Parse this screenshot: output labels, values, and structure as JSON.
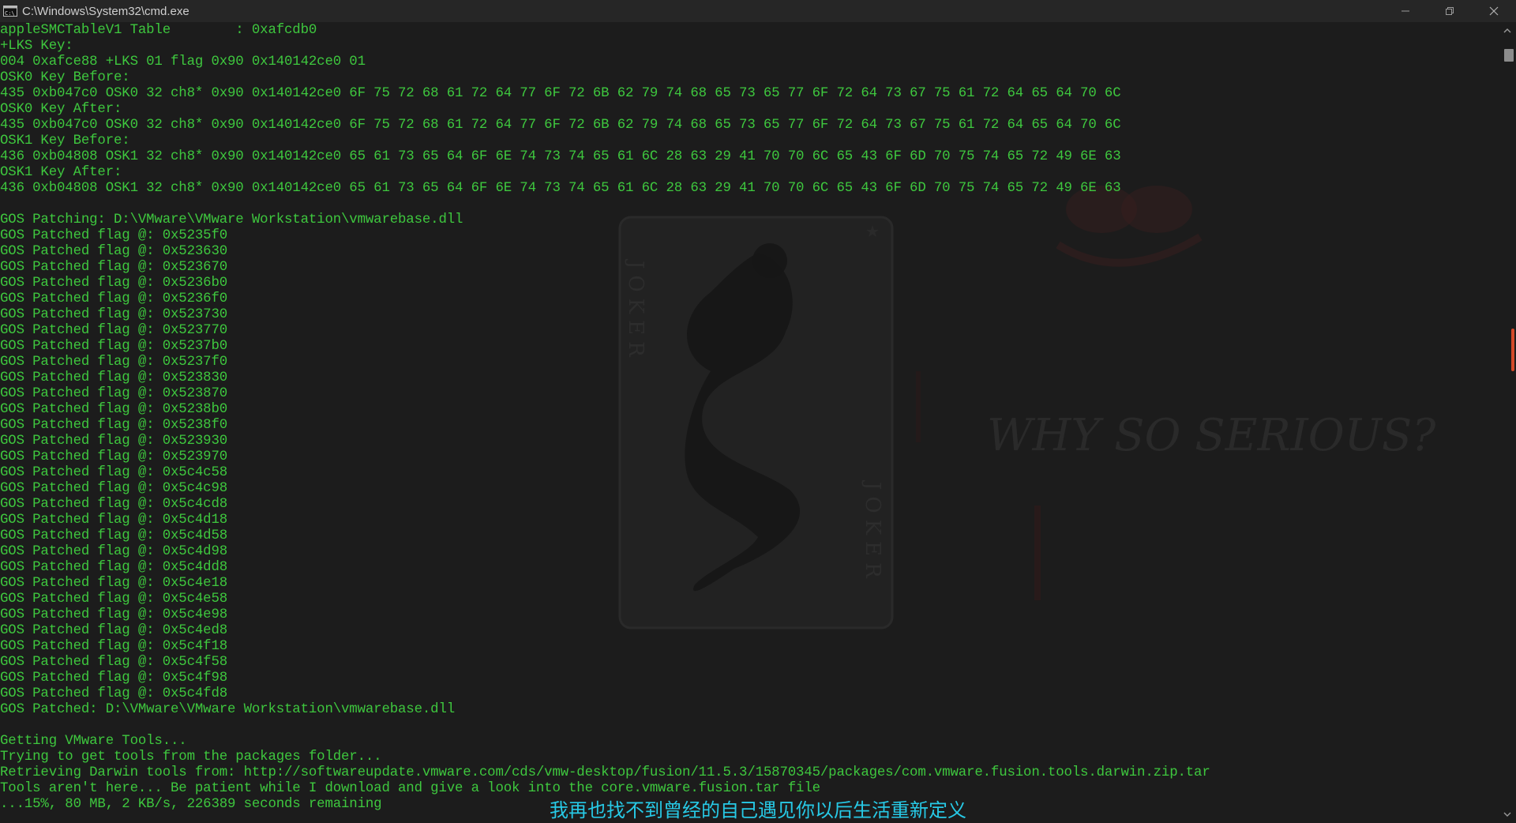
{
  "window": {
    "title": "C:\\Windows\\System32\\cmd.exe",
    "icon": "cmd-icon"
  },
  "controls": {
    "minimize": "minimize-icon",
    "restore": "restore-icon",
    "close": "close-icon"
  },
  "background": {
    "card_letters_left": "JOKER",
    "card_letters_right": "JOKER",
    "graffiti": "WHY SO SERIOUS?"
  },
  "console": {
    "text_color": "#3ec73e",
    "lines": [
      "appleSMCTableV1 Table        : 0xafcdb0",
      "+LKS Key:",
      "004 0xafce88 +LKS 01 flag 0x90 0x140142ce0 01",
      "OSK0 Key Before:",
      "435 0xb047c0 OSK0 32 ch8* 0x90 0x140142ce0 6F 75 72 68 61 72 64 77 6F 72 6B 62 79 74 68 65 73 65 77 6F 72 64 73 67 75 61 72 64 65 64 70 6C",
      "OSK0 Key After:",
      "435 0xb047c0 OSK0 32 ch8* 0x90 0x140142ce0 6F 75 72 68 61 72 64 77 6F 72 6B 62 79 74 68 65 73 65 77 6F 72 64 73 67 75 61 72 64 65 64 70 6C",
      "OSK1 Key Before:",
      "436 0xb04808 OSK1 32 ch8* 0x90 0x140142ce0 65 61 73 65 64 6F 6E 74 73 74 65 61 6C 28 63 29 41 70 70 6C 65 43 6F 6D 70 75 74 65 72 49 6E 63",
      "OSK1 Key After:",
      "436 0xb04808 OSK1 32 ch8* 0x90 0x140142ce0 65 61 73 65 64 6F 6E 74 73 74 65 61 6C 28 63 29 41 70 70 6C 65 43 6F 6D 70 75 74 65 72 49 6E 63",
      "",
      "GOS Patching: D:\\VMware\\VMware Workstation\\vmwarebase.dll",
      "GOS Patched flag @: 0x5235f0",
      "GOS Patched flag @: 0x523630",
      "GOS Patched flag @: 0x523670",
      "GOS Patched flag @: 0x5236b0",
      "GOS Patched flag @: 0x5236f0",
      "GOS Patched flag @: 0x523730",
      "GOS Patched flag @: 0x523770",
      "GOS Patched flag @: 0x5237b0",
      "GOS Patched flag @: 0x5237f0",
      "GOS Patched flag @: 0x523830",
      "GOS Patched flag @: 0x523870",
      "GOS Patched flag @: 0x5238b0",
      "GOS Patched flag @: 0x5238f0",
      "GOS Patched flag @: 0x523930",
      "GOS Patched flag @: 0x523970",
      "GOS Patched flag @: 0x5c4c58",
      "GOS Patched flag @: 0x5c4c98",
      "GOS Patched flag @: 0x5c4cd8",
      "GOS Patched flag @: 0x5c4d18",
      "GOS Patched flag @: 0x5c4d58",
      "GOS Patched flag @: 0x5c4d98",
      "GOS Patched flag @: 0x5c4dd8",
      "GOS Patched flag @: 0x5c4e18",
      "GOS Patched flag @: 0x5c4e58",
      "GOS Patched flag @: 0x5c4e98",
      "GOS Patched flag @: 0x5c4ed8",
      "GOS Patched flag @: 0x5c4f18",
      "GOS Patched flag @: 0x5c4f58",
      "GOS Patched flag @: 0x5c4f98",
      "GOS Patched flag @: 0x5c4fd8",
      "GOS Patched: D:\\VMware\\VMware Workstation\\vmwarebase.dll",
      "",
      "Getting VMware Tools...",
      "Trying to get tools from the packages folder...",
      "Retrieving Darwin tools from: http://softwareupdate.vmware.com/cds/vmw-desktop/fusion/11.5.3/15870345/packages/com.vmware.fusion.tools.darwin.zip.tar",
      "Tools aren't here... Be patient while I download and give a look into the core.vmware.fusion.tar file",
      "...15%, 80 MB, 2 KB/s, 226389 seconds remaining"
    ]
  },
  "subtitle": {
    "text": "我再也找不到曾经的自己遇见你以后生活重新定义",
    "color": "#27c9e6"
  },
  "scrollbar": {
    "up": "scroll-up-arrow-icon",
    "down": "scroll-down-arrow-icon"
  }
}
